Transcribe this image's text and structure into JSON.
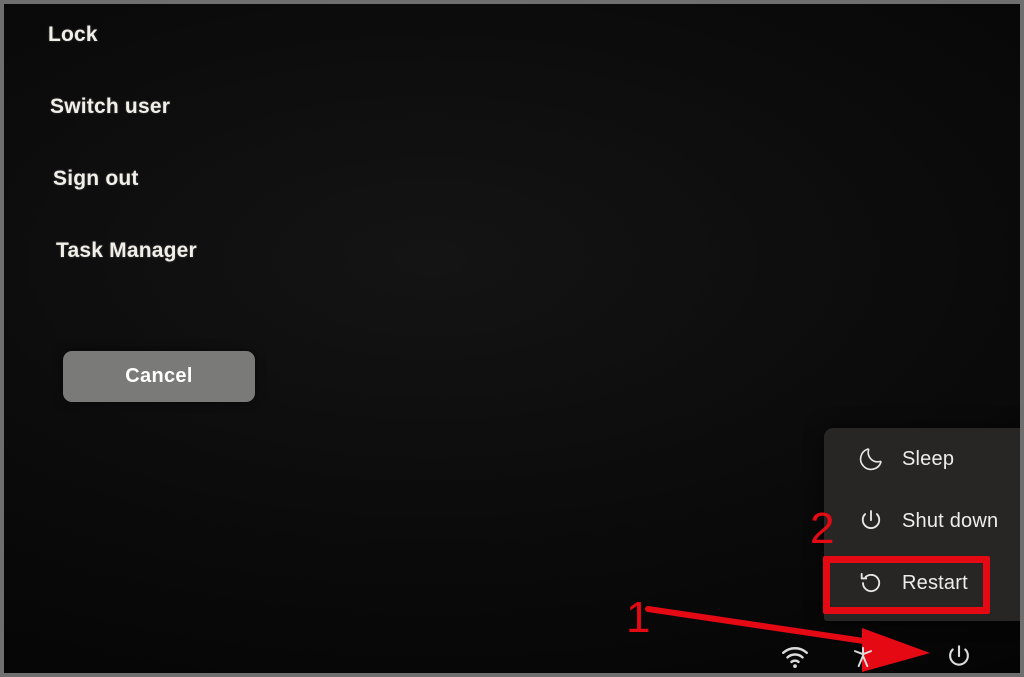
{
  "screen": {
    "background_color": "#000000",
    "accent_annotation_color": "#e50914"
  },
  "options": {
    "lock": "Lock",
    "switch_user": "Switch user",
    "sign_out": "Sign out",
    "task_manager": "Task Manager"
  },
  "cancel": {
    "label": "Cancel"
  },
  "power_flyout": {
    "items": [
      {
        "label": "Sleep",
        "icon": "moon-icon"
      },
      {
        "label": "Shut down",
        "icon": "power-icon"
      },
      {
        "label": "Restart",
        "icon": "restart-icon"
      }
    ]
  },
  "annotations": {
    "step_1": "1",
    "step_2": "2"
  },
  "tray": {
    "icons": [
      {
        "name": "wifi-icon"
      },
      {
        "name": "accessibility-icon"
      },
      {
        "name": "power-button-icon"
      }
    ]
  }
}
